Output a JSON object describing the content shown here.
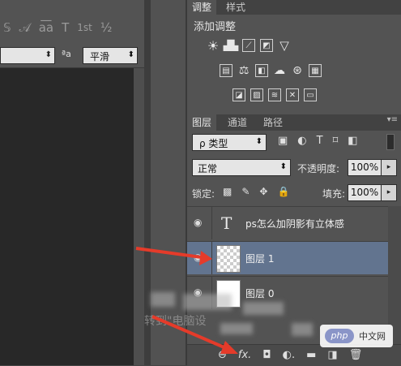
{
  "character_panel": {
    "format_glyphs": [
      "𝕊",
      "𝒜",
      "a͞a",
      "T",
      "1st",
      "½"
    ],
    "antialias_icon": "ªa",
    "antialias_value": "平滑"
  },
  "adjustments_panel": {
    "tabs": [
      "调整",
      "样式"
    ],
    "title": "添加调整",
    "row1": [
      "brightness-icon",
      "levels-icon",
      "curves-icon",
      "exposure-icon",
      "vibrance-icon"
    ],
    "row2": [
      "hue-saturation-icon",
      "color-balance-icon",
      "black-white-icon",
      "photo-filter-icon",
      "channel-mixer-icon",
      "color-lookup-icon"
    ],
    "row3": [
      "invert-icon",
      "posterize-icon",
      "threshold-icon",
      "selective-color-icon",
      "gradient-map-icon"
    ]
  },
  "layers_panel": {
    "tabs": [
      "图层",
      "通道",
      "路径"
    ],
    "filter_value": "ρ 类型",
    "filter_icons": [
      "▣",
      "◐",
      "T",
      "⌑",
      "◧"
    ],
    "blend_mode": "正常",
    "opacity_label": "不透明度:",
    "opacity_value": "100%",
    "lock_label": "锁定:",
    "lock_icons": [
      "▩",
      "✎",
      "✥",
      "🔒"
    ],
    "fill_label": "填充:",
    "fill_value": "100%",
    "layers": [
      {
        "name": "ps怎么加阴影有立体感",
        "kind": "text"
      },
      {
        "name": "图层 1",
        "kind": "transparent",
        "selected": true
      },
      {
        "name": "图层 0",
        "kind": "white"
      }
    ],
    "bottom_icons": [
      "⊖",
      "fx.",
      "◘",
      "◐.",
      "▬",
      "◨",
      "🗑"
    ]
  },
  "watermark": {
    "text": "转到\"电脑设",
    "php_logo": "php",
    "php_text": "中文网"
  },
  "colors": {
    "selected_layer": "#62748f",
    "arrow": "#e53b2a"
  }
}
